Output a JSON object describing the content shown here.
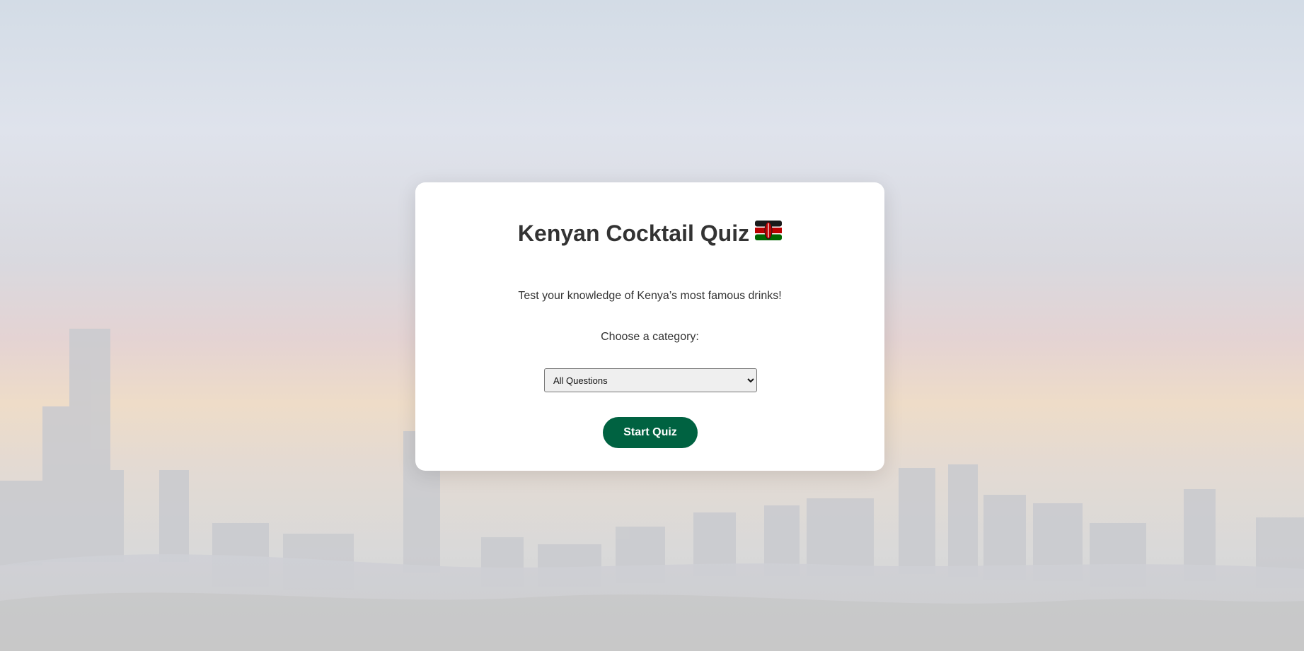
{
  "quiz": {
    "title": "Kenyan Cocktail Quiz",
    "flag_icon": "kenya-flag-icon",
    "subtitle": "Test your knowledge of Kenya’s most famous drinks!",
    "category_label": "Choose a category:",
    "category_selected": "All Questions",
    "start_button": "Start Quiz"
  },
  "colors": {
    "accent": "#006241",
    "title_text": "#333333",
    "card_background": "#ffffff"
  }
}
